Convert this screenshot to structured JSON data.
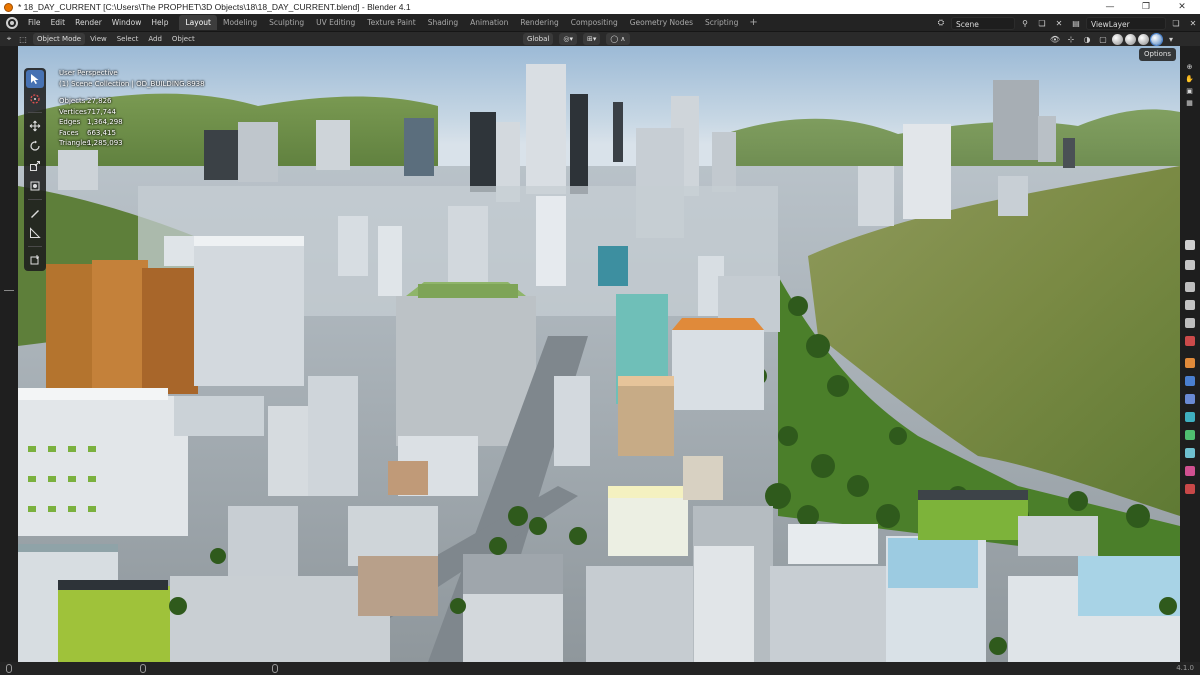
{
  "window": {
    "title": "* 18_DAY_CURRENT [C:\\Users\\The PROPHET\\3D Objects\\18\\18_DAY_CURRENT.blend] - Blender 4.1",
    "controls": [
      "—",
      "❐",
      "✕"
    ]
  },
  "menus": [
    "File",
    "Edit",
    "Render",
    "Window",
    "Help"
  ],
  "workspaces": [
    {
      "label": "Layout",
      "active": true
    },
    {
      "label": "Modeling"
    },
    {
      "label": "Sculpting"
    },
    {
      "label": "UV Editing"
    },
    {
      "label": "Texture Paint"
    },
    {
      "label": "Shading"
    },
    {
      "label": "Animation"
    },
    {
      "label": "Rendering"
    },
    {
      "label": "Compositing"
    },
    {
      "label": "Geometry Nodes"
    },
    {
      "label": "Scripting"
    }
  ],
  "workspace_add": "+",
  "scene": {
    "label": "Scene",
    "view_layer": "ViewLayer"
  },
  "viewport_header": {
    "mode": "Object Mode",
    "menus": [
      "View",
      "Select",
      "Add",
      "Object"
    ],
    "orientation": "Global",
    "options": "Options"
  },
  "overlay": {
    "perspective": "User Perspective",
    "collection": "(1) Scene Collection | OD_BUILDING.8938",
    "stats": [
      {
        "label": "Objects",
        "value": "27,826"
      },
      {
        "label": "Vertices",
        "value": "717,744"
      },
      {
        "label": "Edges",
        "value": "1,364,298"
      },
      {
        "label": "Faces",
        "value": "663,415"
      },
      {
        "label": "Triangles",
        "value": "1,285,093"
      }
    ]
  },
  "tools": [
    "select-box",
    "cursor",
    "move",
    "rotate",
    "scale",
    "transform",
    "annotate",
    "measure",
    "add-cube"
  ],
  "status": {
    "version": "4.1.0"
  },
  "colors": {
    "accent": "#4772b3",
    "ui_dark": "#232323",
    "header": "#2a2a2a",
    "sky": "#c7d7e4",
    "grass": "#5d8a3a",
    "hill": "#7d8f4a"
  }
}
